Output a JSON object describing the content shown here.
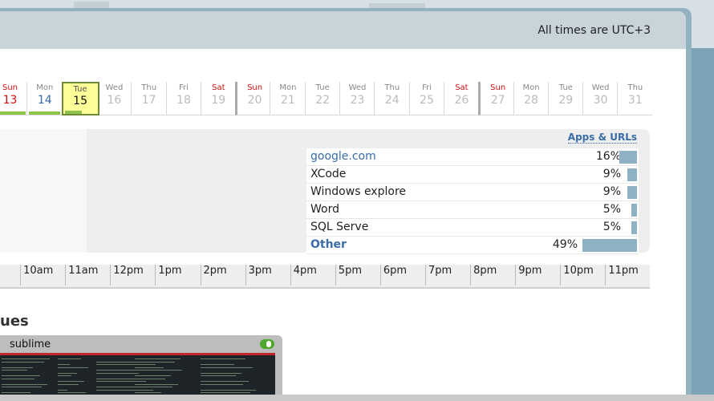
{
  "header": {
    "timezone_note": "All times are UTC+3"
  },
  "calendar": {
    "days": [
      {
        "name": "Sun",
        "num": "13",
        "weekend": true,
        "past": true,
        "has_data": true
      },
      {
        "name": "Mon",
        "num": "14",
        "weekend": false,
        "past": true,
        "has_data": true
      },
      {
        "name": "Tue",
        "num": "15",
        "weekend": false,
        "past": true,
        "has_data": true,
        "today": true
      },
      {
        "name": "Wed",
        "num": "16"
      },
      {
        "name": "Thu",
        "num": "17"
      },
      {
        "name": "Fri",
        "num": "18"
      },
      {
        "name": "Sat",
        "num": "19",
        "weekend": true
      },
      {
        "name": "Sun",
        "num": "20",
        "weekend": true
      },
      {
        "name": "Mon",
        "num": "21"
      },
      {
        "name": "Tue",
        "num": "22"
      },
      {
        "name": "Wed",
        "num": "23"
      },
      {
        "name": "Thu",
        "num": "24"
      },
      {
        "name": "Fri",
        "num": "25"
      },
      {
        "name": "Sat",
        "num": "26",
        "weekend": true
      },
      {
        "name": "Sun",
        "num": "27",
        "weekend": true
      },
      {
        "name": "Mon",
        "num": "28"
      },
      {
        "name": "Tue",
        "num": "29"
      },
      {
        "name": "Wed",
        "num": "30"
      },
      {
        "name": "Thu",
        "num": "31"
      }
    ]
  },
  "apps": {
    "title": "Apps & URLs",
    "items": [
      {
        "name": "google.com",
        "pct": "16%",
        "share": 0.16,
        "link": true
      },
      {
        "name": "XCode",
        "pct": "9%",
        "share": 0.09
      },
      {
        "name": "Windows explore",
        "pct": "9%",
        "share": 0.09
      },
      {
        "name": "Word",
        "pct": "5%",
        "share": 0.05
      },
      {
        "name": "SQL Serve",
        "pct": "5%",
        "share": 0.05
      },
      {
        "name": "Other",
        "pct": "49%",
        "share": 0.49,
        "link": true,
        "bold": true
      }
    ]
  },
  "hours": [
    "",
    "10am",
    "11am",
    "12pm",
    "1pm",
    "2pm",
    "3pm",
    "4pm",
    "5pm",
    "6pm",
    "7pm",
    "8pm",
    "9pm",
    "10pm",
    "11pm"
  ],
  "section": {
    "title": "ues"
  },
  "screenshot": {
    "label": "sublime"
  },
  "colors": {
    "accent_blue": "#3a6da8",
    "weekend_red": "#d01010",
    "activity_green": "#8fc34a",
    "today_yellow": "#ffff99",
    "bar_blue": "#8eb2c3"
  }
}
